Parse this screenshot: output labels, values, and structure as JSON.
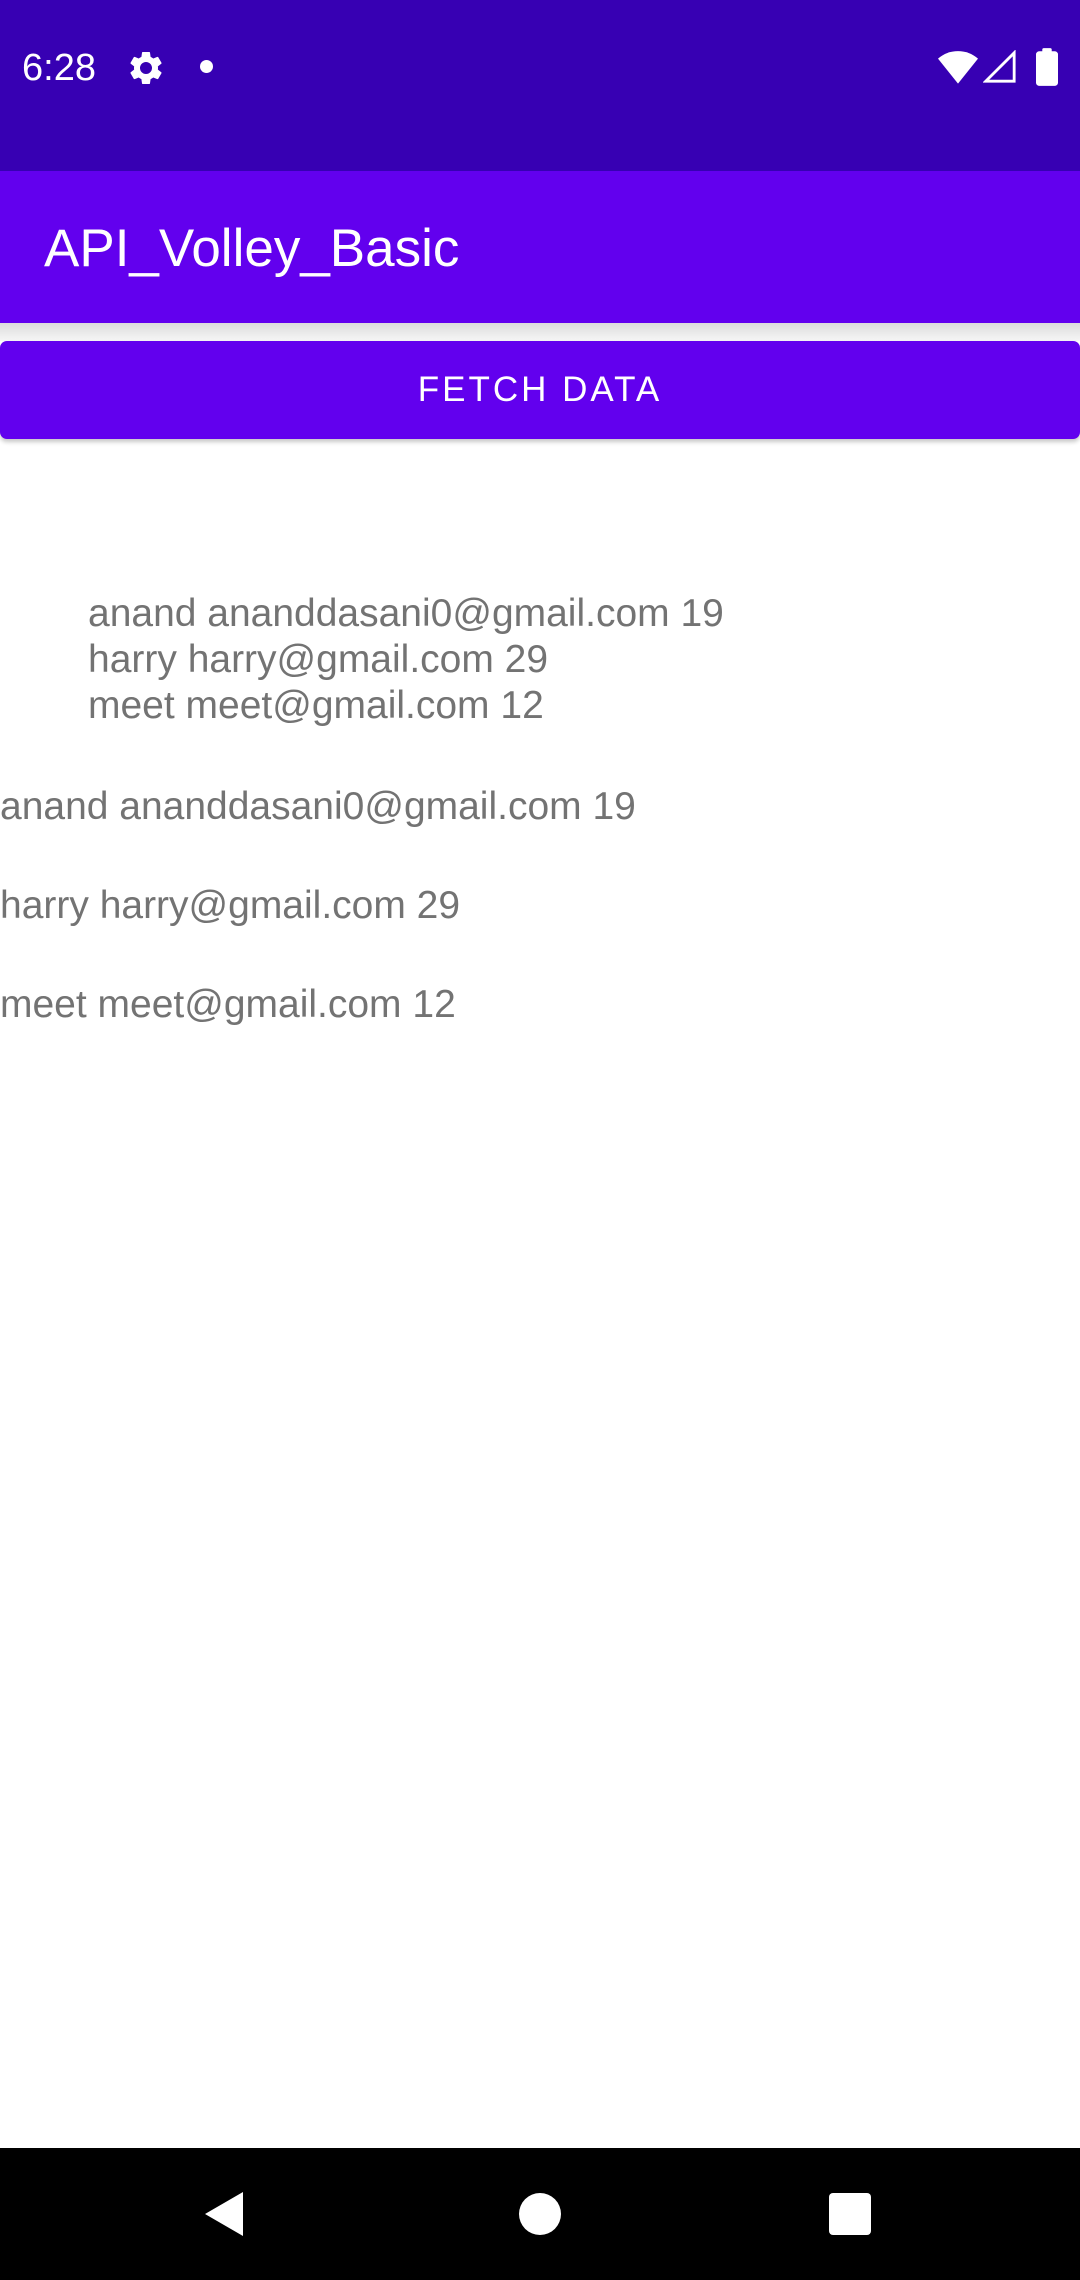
{
  "status_bar": {
    "time": "6:28",
    "icons": [
      "gear-icon",
      "notification-dot-icon",
      "wifi-icon",
      "cell-signal-icon",
      "battery-icon"
    ],
    "background_color": "#3700b3"
  },
  "app_bar": {
    "title": "API_Volley_Basic",
    "background_color": "#6200ee"
  },
  "fetch_button": {
    "label": "FETCH DATA",
    "background_color": "#6200ee"
  },
  "multi_line_text": {
    "lines": [
      "anand ananddasani0@gmail.com 19",
      "harry harry@gmail.com 29",
      "meet meet@gmail.com 12"
    ]
  },
  "list": {
    "items": [
      "anand ananddasani0@gmail.com 19",
      "harry harry@gmail.com 29",
      "meet meet@gmail.com 12"
    ]
  },
  "nav_bar": {
    "icons": [
      "back-icon",
      "home-icon",
      "recents-icon"
    ]
  }
}
